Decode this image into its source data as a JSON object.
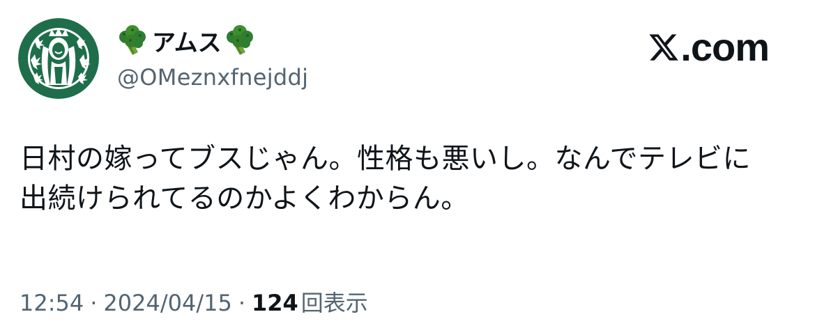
{
  "colors": {
    "text_primary": "#0f1419",
    "text_secondary": "#536471",
    "avatar_green": "#1e6e4a",
    "emoji_green": "#3e8e2e"
  },
  "author": {
    "display_name": "アムス",
    "name_emoji": "broccoli-emoji",
    "handle": "@OMeznxfnejddj",
    "avatar_icon": "siren-logo-parody-icon"
  },
  "brand": {
    "logo_icon": "x-logo-icon",
    "label": ".com"
  },
  "tweet": {
    "lines": [
      "日村の嫁ってブスじゃん。性格も悪いし。なんでテレビに",
      "出続けられてるのかよくわからん。"
    ]
  },
  "meta": {
    "time": "12:54",
    "separator": "·",
    "date": "2024/04/15",
    "views_count": "124",
    "views_label": "回表示"
  }
}
